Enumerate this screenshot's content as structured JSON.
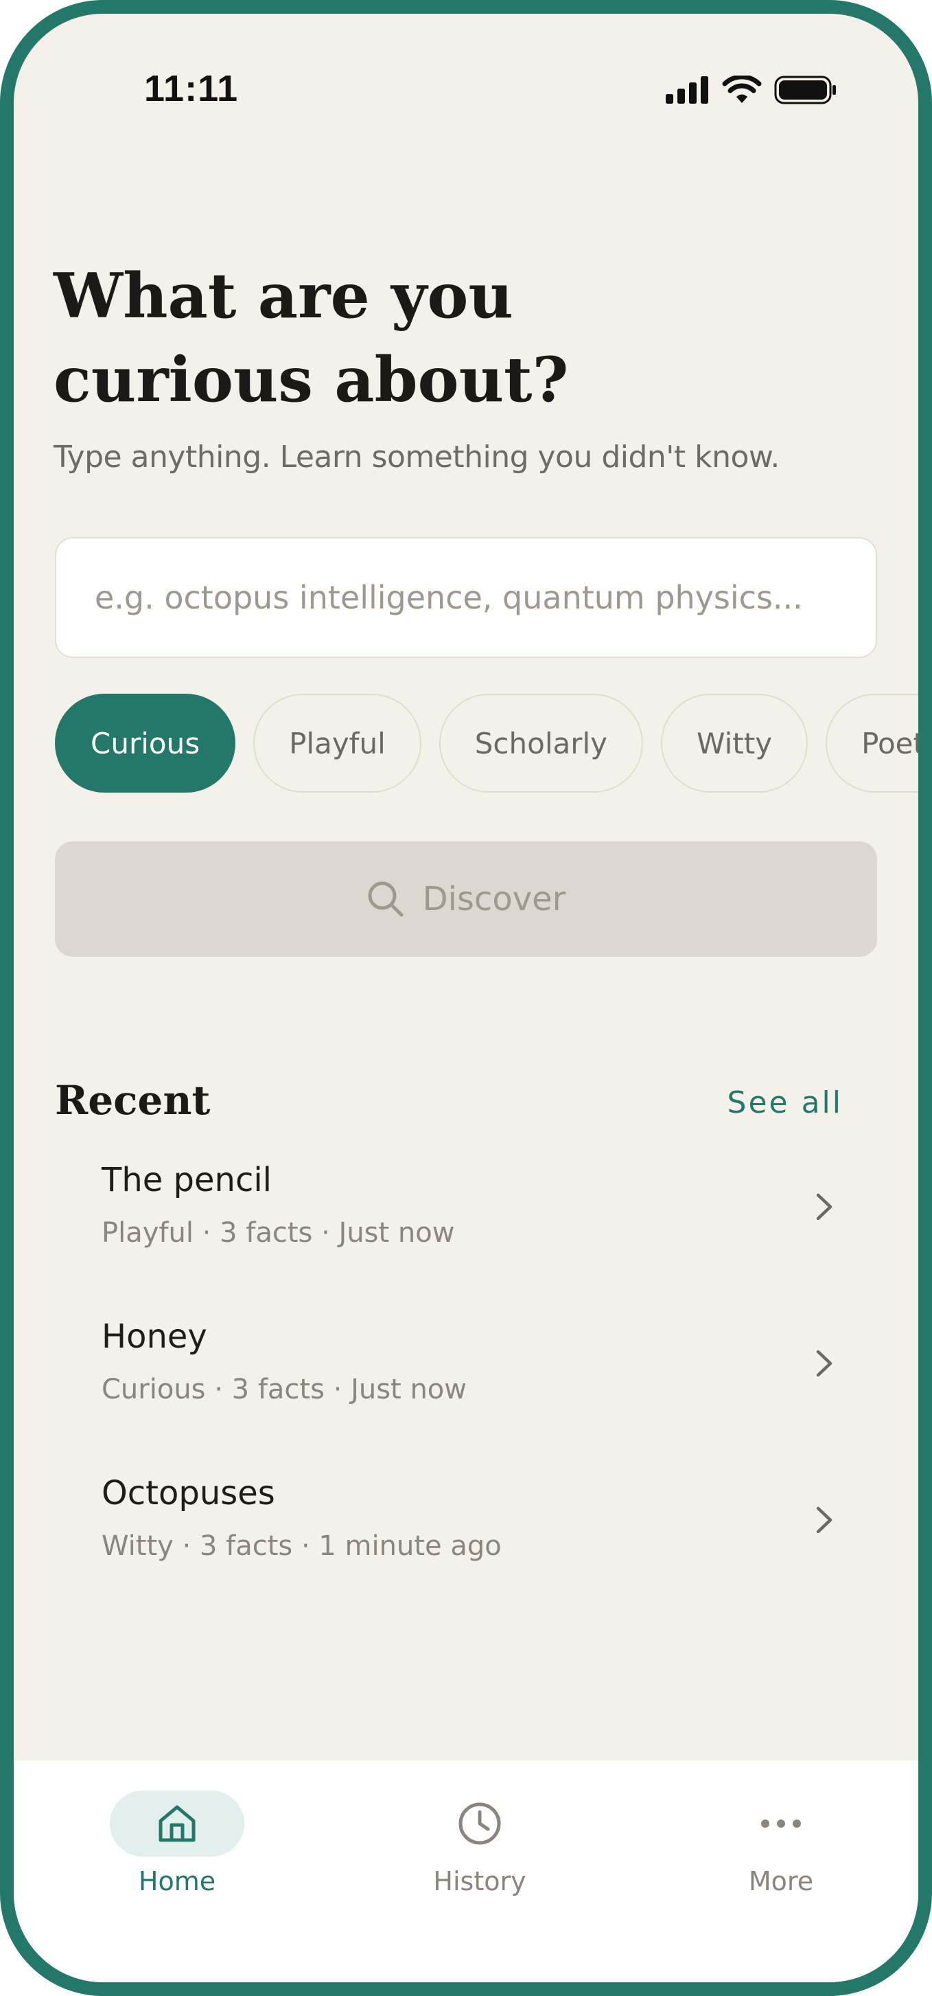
{
  "status_bar": {
    "time": "11:11"
  },
  "hero": {
    "title_line1": "What are you",
    "title_line2": "curious about?",
    "subtitle": "Type anything. Learn something you didn't know."
  },
  "search": {
    "placeholder": "e.g. octopus intelligence, quantum physics...",
    "value": ""
  },
  "tones": [
    {
      "label": "Curious",
      "selected": true
    },
    {
      "label": "Playful",
      "selected": false
    },
    {
      "label": "Scholarly",
      "selected": false
    },
    {
      "label": "Witty",
      "selected": false
    },
    {
      "label": "Poetic",
      "selected": false
    }
  ],
  "discover_button": {
    "label": "Discover",
    "icon": "search-icon"
  },
  "recent": {
    "title": "Recent",
    "see_all": "See all",
    "items": [
      {
        "title": "The pencil",
        "meta": "Playful · 3 facts · Just now"
      },
      {
        "title": "Honey",
        "meta": "Curious · 3 facts · Just now"
      },
      {
        "title": "Octopuses",
        "meta": "Witty · 3 facts · 1 minute ago"
      }
    ]
  },
  "nav": [
    {
      "label": "Home",
      "icon": "home-icon",
      "active": true
    },
    {
      "label": "History",
      "icon": "clock-icon",
      "active": false
    },
    {
      "label": "More",
      "icon": "more-icon",
      "active": false
    }
  ],
  "colors": {
    "accent": "#24786a",
    "background": "#f4f1eb",
    "disabled": "#dcd8d1"
  }
}
